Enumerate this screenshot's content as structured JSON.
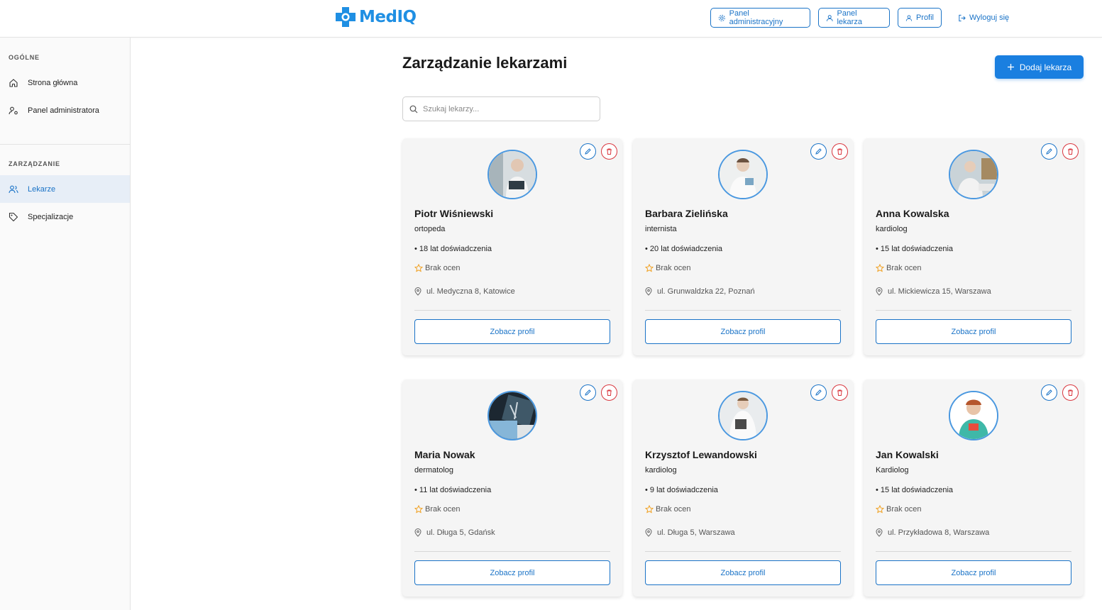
{
  "app": {
    "logo_text": "MedIQ"
  },
  "header": {
    "admin_panel": "Panel administracyjny",
    "doctor_panel": "Panel lekarza",
    "profile": "Profil",
    "logout": "Wyloguj się"
  },
  "sidebar": {
    "general_label": "OGÓLNE",
    "general_items": [
      {
        "label": "Strona główna",
        "icon": "home-icon"
      },
      {
        "label": "Panel administratora",
        "icon": "user-cog-icon"
      }
    ],
    "management_label": "ZARZĄDZANIE",
    "management_items": [
      {
        "label": "Lekarze",
        "icon": "users-icon",
        "active": true
      },
      {
        "label": "Specjalizacje",
        "icon": "tag-icon"
      }
    ]
  },
  "main": {
    "title": "Zarządzanie lekarzami",
    "add_button": "Dodaj lekarza",
    "search_placeholder": "Szukaj lekarzy...",
    "profile_button": "Zobacz profil",
    "doctors": [
      {
        "name": "Piotr Wiśniewski",
        "specialty": "ortopeda",
        "experience": "• 18 lat doświadczenia",
        "rating": "Brak ocen",
        "address": "ul. Medyczna 8, Katowice"
      },
      {
        "name": "Barbara Zielińska",
        "specialty": "internista",
        "experience": "• 20 lat doświadczenia",
        "rating": "Brak ocen",
        "address": "ul. Grunwaldzka 22, Poznań"
      },
      {
        "name": "Anna Kowalska",
        "specialty": "kardiolog",
        "experience": "• 15 lat doświadczenia",
        "rating": "Brak ocen",
        "address": "ul. Mickiewicza 15, Warszawa"
      },
      {
        "name": "Maria Nowak",
        "specialty": "dermatolog",
        "experience": "• 11 lat doświadczenia",
        "rating": "Brak ocen",
        "address": "ul. Długa 5, Gdańsk"
      },
      {
        "name": "Krzysztof Lewandowski",
        "specialty": "kardiolog",
        "experience": "• 9 lat doświadczenia",
        "rating": "Brak ocen",
        "address": "ul. Długa 5, Warszawa"
      },
      {
        "name": "Jan Kowalski",
        "specialty": "Kardiolog",
        "experience": "• 15 lat doświadczenia",
        "rating": "Brak ocen",
        "address": "ul. Przykładowa 8, Warszawa"
      }
    ]
  },
  "colors": {
    "primary": "#1a7fe0",
    "danger": "#d9363e",
    "star": "#f0a020"
  }
}
